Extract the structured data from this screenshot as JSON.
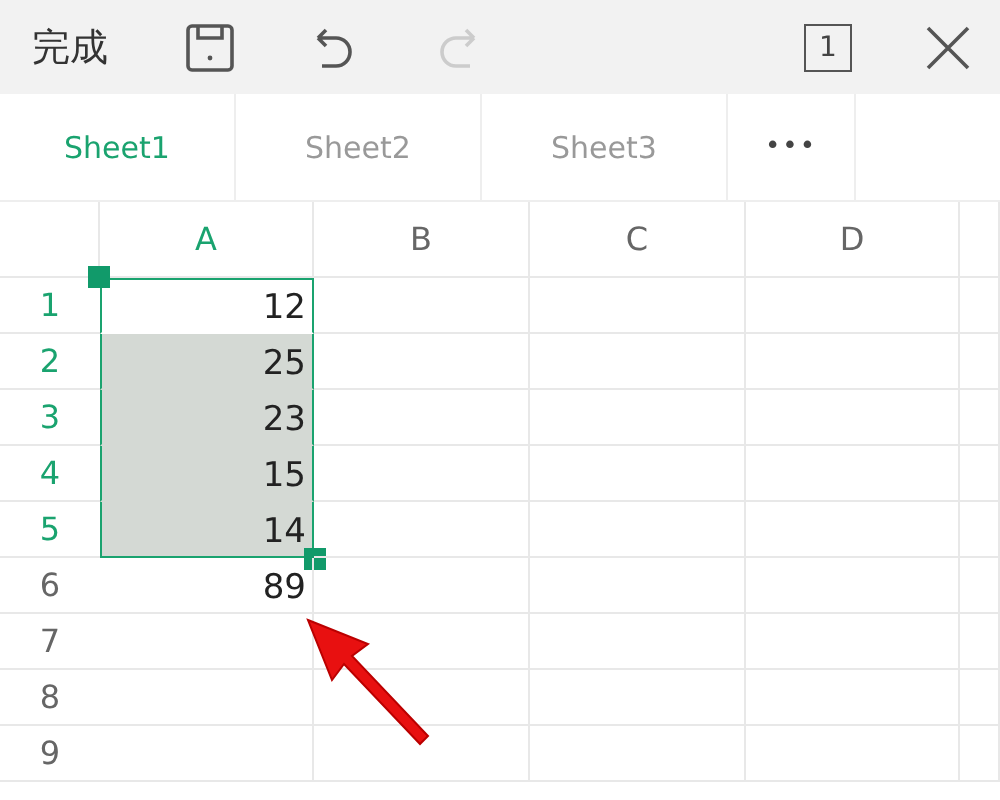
{
  "toolbar": {
    "done": "完成",
    "redo_disabled": true,
    "sheet_count": "1"
  },
  "tabs": [
    {
      "label": "Sheet1",
      "selected": true
    },
    {
      "label": "Sheet2",
      "selected": false
    },
    {
      "label": "Sheet3",
      "selected": false
    }
  ],
  "more": "•••",
  "columns": [
    {
      "label": "A",
      "selected": true
    },
    {
      "label": "B",
      "selected": false
    },
    {
      "label": "C",
      "selected": false
    },
    {
      "label": "D",
      "selected": false
    }
  ],
  "rows": [
    {
      "number": "1",
      "selected": true,
      "active": true,
      "value": "12"
    },
    {
      "number": "2",
      "selected": true,
      "active": false,
      "value": "25"
    },
    {
      "number": "3",
      "selected": true,
      "active": false,
      "value": "23"
    },
    {
      "number": "4",
      "selected": true,
      "active": false,
      "value": "15"
    },
    {
      "number": "5",
      "selected": true,
      "active": false,
      "value": "14"
    },
    {
      "number": "6",
      "selected": false,
      "active": false,
      "value": "89"
    },
    {
      "number": "7",
      "selected": false,
      "active": false
    },
    {
      "number": "8",
      "selected": false,
      "active": false
    },
    {
      "number": "9",
      "selected": false,
      "active": false
    }
  ]
}
